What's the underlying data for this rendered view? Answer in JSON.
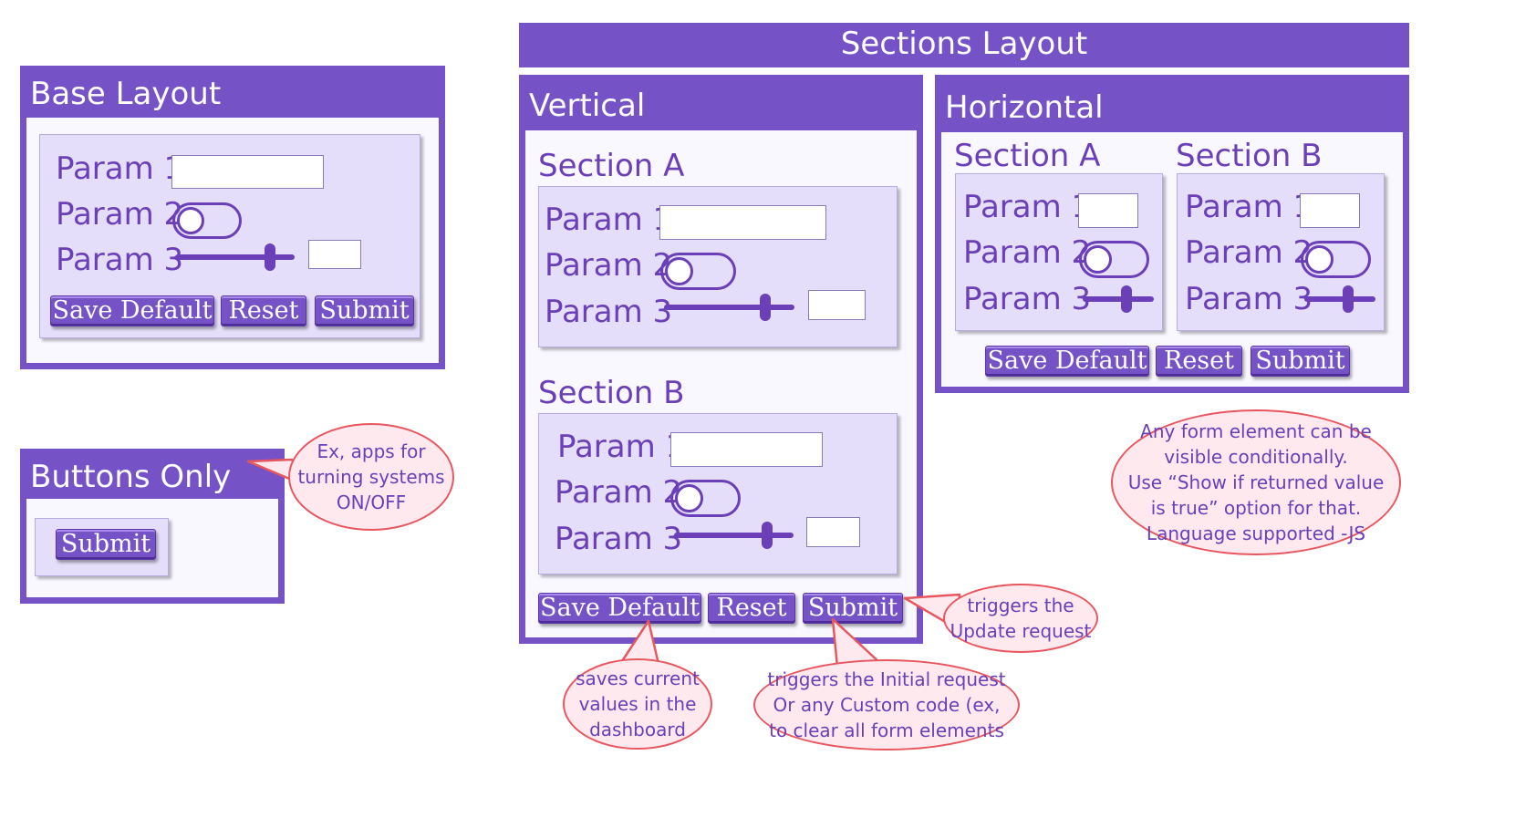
{
  "colors": {
    "accent": "#7652c7",
    "panel": "#e4defa",
    "text": "#6a3fb8",
    "callout_border": "#e8575f",
    "callout_fill": "#fde9ee"
  },
  "base_layout": {
    "title": "Base Layout",
    "params": [
      "Param 1",
      "Param 2",
      "Param 3"
    ],
    "buttons": {
      "save": "Save Default",
      "reset": "Reset",
      "submit": "Submit"
    }
  },
  "buttons_only": {
    "title": "Buttons Only",
    "submit": "Submit"
  },
  "sections_layout": {
    "banner": "Sections Layout",
    "vertical": {
      "title": "Vertical",
      "section_a": {
        "title": "Section A",
        "params": [
          "Param 1",
          "Param 2",
          "Param 3"
        ]
      },
      "section_b": {
        "title": "Section B",
        "params": [
          "Param 1",
          "Param 2",
          "Param 3"
        ]
      },
      "buttons": {
        "save": "Save Default",
        "reset": "Reset",
        "submit": "Submit"
      }
    },
    "horizontal": {
      "title": "Horizontal",
      "section_a": {
        "title": "Section A",
        "params": [
          "Param 1",
          "Param 2",
          "Param 3"
        ]
      },
      "section_b": {
        "title": "Section B",
        "params": [
          "Param 1",
          "Param 2",
          "Param 3"
        ]
      },
      "buttons": {
        "save": "Save Default",
        "reset": "Reset",
        "submit": "Submit"
      }
    }
  },
  "callouts": {
    "buttons_only": [
      "Ex, apps for",
      "turning systems",
      "ON/OFF"
    ],
    "conditional": [
      "Any form element can be",
      "visible conditionally.",
      "Use “Show if returned value",
      "is true” option for that.",
      "Language supported -JS"
    ],
    "update": [
      "triggers the",
      "Update request"
    ],
    "save_default": [
      "saves current",
      "values in the",
      "dashboard"
    ],
    "submit_initial": [
      "triggers the Initial request",
      "Or any Custom code (ex,",
      "to clear all form elements"
    ]
  }
}
